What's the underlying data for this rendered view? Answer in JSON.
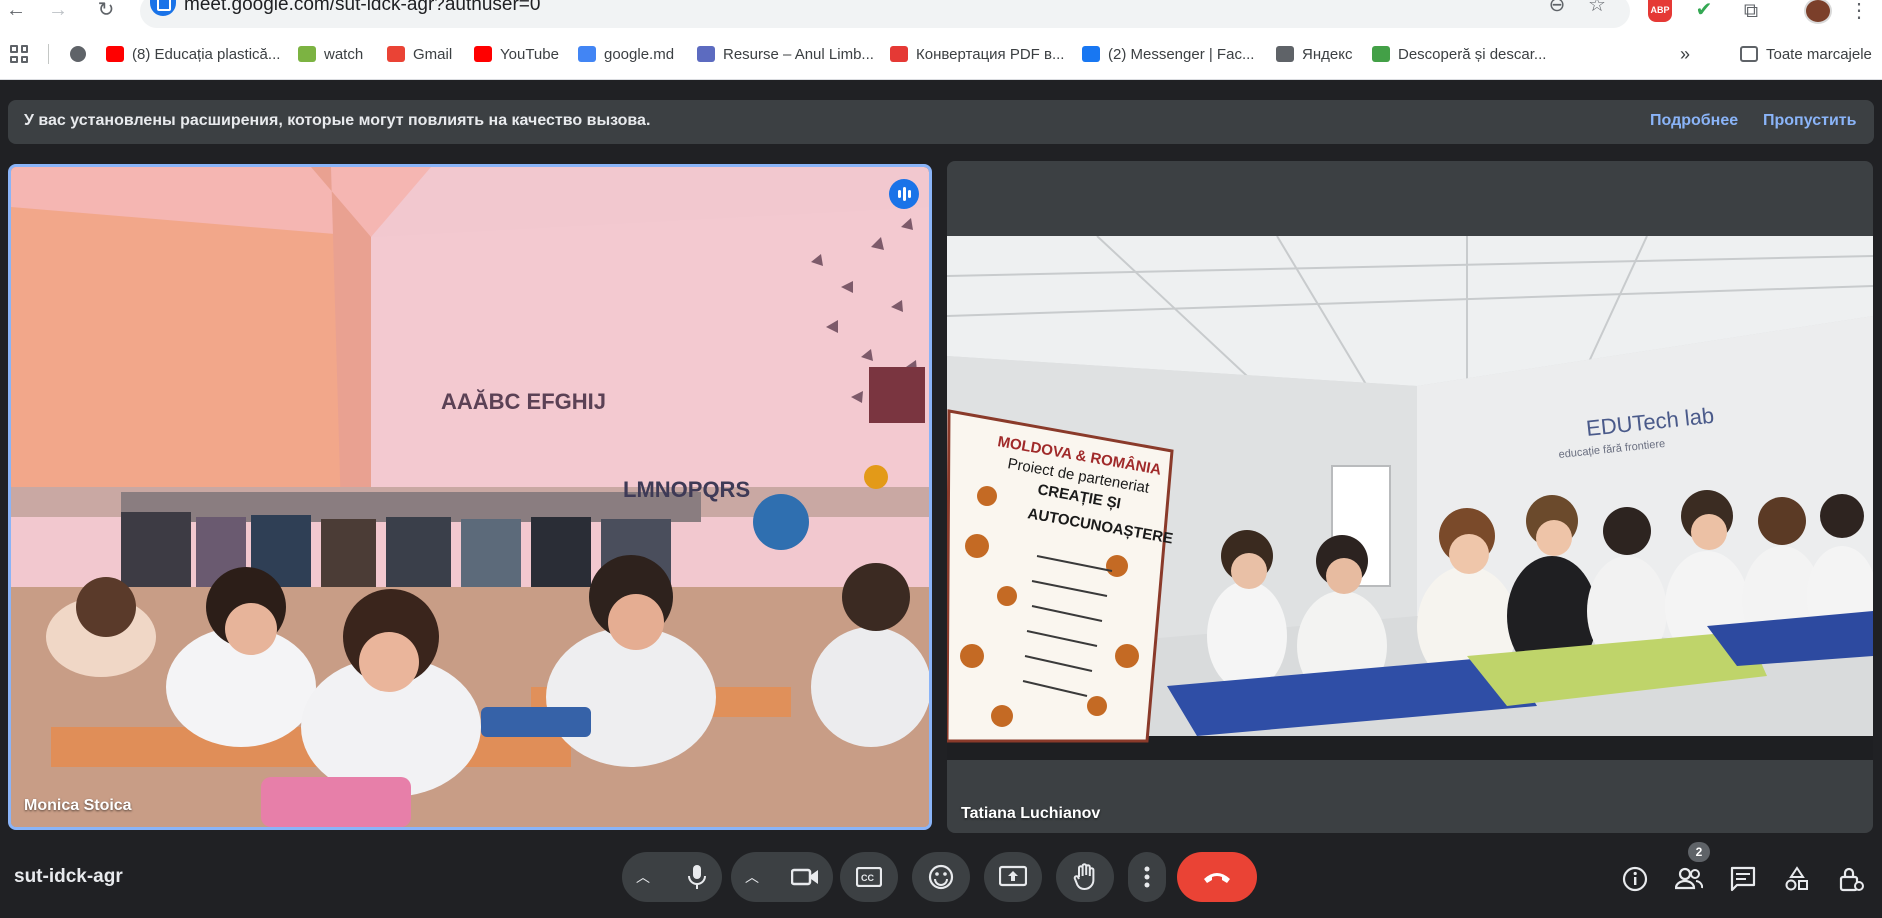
{
  "browser": {
    "url": "meet.google.com/sut-idck-agr?authuser=0",
    "bookmarks": [
      {
        "label": "(8) Educația plastică...",
        "icon": "youtube-icon",
        "color": "#ff0000"
      },
      {
        "label": "watch",
        "icon": "download-icon",
        "color": "#7cb342"
      },
      {
        "label": "Gmail",
        "icon": "gmail-icon",
        "color": "#ea4335"
      },
      {
        "label": "YouTube",
        "icon": "youtube-icon",
        "color": "#ff0000"
      },
      {
        "label": "google.md",
        "icon": "google-icon",
        "color": "#4285f4"
      },
      {
        "label": "Resurse – Anul Limb...",
        "icon": "globe-icon",
        "color": "#5c6bc0"
      },
      {
        "label": "Конвертация PDF в...",
        "icon": "heart-icon",
        "color": "#e53935"
      },
      {
        "label": "(2) Messenger | Fac...",
        "icon": "facebook-icon",
        "color": "#1877f2"
      },
      {
        "label": "Яндекс",
        "icon": "globe-icon",
        "color": "#5f6368"
      },
      {
        "label": "Descoperă și descar...",
        "icon": "px-icon",
        "color": "#43a047"
      }
    ],
    "overflow": "»",
    "all_bookmarks": "Toate marcajele",
    "abp_label": "ABP"
  },
  "meet": {
    "banner_text": "У вас установлены расширения, которые могут повлиять на качество вызова.",
    "banner_more": "Подробнее",
    "banner_skip": "Пропустить",
    "participants": [
      {
        "name": "Monica Stoica",
        "speaking": true
      },
      {
        "name": "Tatiana Luchianov",
        "speaking": false
      }
    ],
    "meeting_code": "sut-idck-agr",
    "people_count": "2"
  },
  "poster": {
    "title_lines": [
      "MOLDOVA & ROMÂNIA",
      "Proiect de parteneriat",
      "CREAȚIE ȘI",
      "AUTOCUNOAȘTERE"
    ],
    "wall_letters_1": "AAĂBC EFGHIJ",
    "wall_letters_2": "LMNOPQRS",
    "wall_brand": "EDUTech lab",
    "wall_brand_sub": "educație fără frontiere"
  },
  "colors": {
    "accent": "#8ab4f8",
    "end_call": "#ea4335",
    "background": "#202124",
    "surface": "#3c4043"
  }
}
